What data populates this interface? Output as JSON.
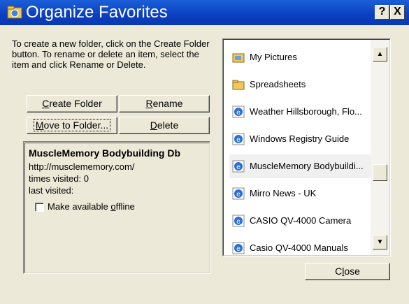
{
  "window": {
    "title": "Organize Favorites",
    "help_label": "?",
    "close_label": "X"
  },
  "instructions": "To create a new folder, click on the Create Folder button. To rename or delete an item, select the item and click Rename or Delete.",
  "buttons": {
    "create_folder": {
      "label": "Create Folder",
      "accel": "C",
      "rest": "reate Folder"
    },
    "rename": {
      "label": "Rename",
      "accel": "R",
      "rest": "ename"
    },
    "move_to_folder": {
      "label": "Move to Folder...",
      "accel": "M",
      "rest": "ove to Folder..."
    },
    "delete": {
      "label": "Delete",
      "accel": "D",
      "rest": "elete"
    },
    "close": {
      "label": "Close",
      "pre": "C",
      "accel": "l",
      "rest": "ose"
    }
  },
  "details": {
    "name": "MuscleMemory Bodybuilding Db",
    "url": "http://musclememory.com/",
    "times_visited": "times visited: 0",
    "last_visited": "last visited:",
    "offline_checkbox": {
      "label": "Make available offline",
      "pre": "Make available ",
      "accel": "o",
      "rest": "ffline",
      "checked": false
    }
  },
  "favorites": [
    {
      "label": "My Pictures",
      "icon": "folder-pictures-icon"
    },
    {
      "label": "Spreadsheets",
      "icon": "folder-icon"
    },
    {
      "label": "Weather Hillsborough, Flo...",
      "icon": "ie-link-icon"
    },
    {
      "label": "Windows Registry Guide",
      "icon": "ie-link-icon"
    },
    {
      "label": "MuscleMemory Bodybuildi...",
      "icon": "ie-link-icon",
      "selected": true
    },
    {
      "label": "Mirro News - UK",
      "icon": "ie-link-icon"
    },
    {
      "label": "CASIO QV-4000 Camera",
      "icon": "ie-link-icon"
    },
    {
      "label": "Casio QV-4000 Manuals",
      "icon": "ie-link-icon"
    }
  ],
  "colors": {
    "titlebar": "#0b3fc0",
    "face": "#ece9d8"
  }
}
